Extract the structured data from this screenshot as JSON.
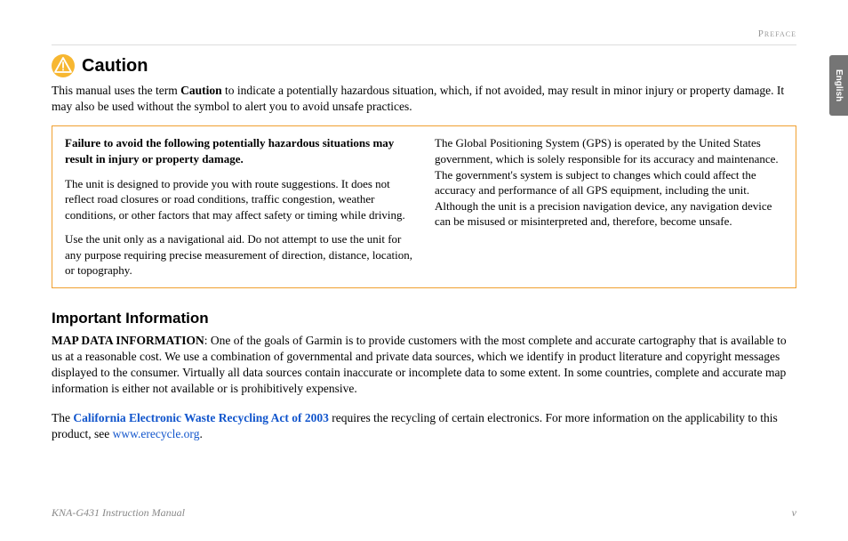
{
  "header": {
    "section_label": "Preface",
    "language_tab": "English"
  },
  "caution": {
    "title": "Caution",
    "intro_pre": "This manual uses the term ",
    "intro_bold": "Caution",
    "intro_post": " to indicate a potentially hazardous situation, which, if not avoided, may result in minor injury or property damage. It may also be used without the symbol to alert you to avoid unsafe practices.",
    "box": {
      "left": {
        "p1_bold": "Failure to avoid the following potentially hazardous situations may result in injury or property damage.",
        "p2": "The unit is designed to provide you with route suggestions. It does not reflect road closures or road conditions, traffic congestion, weather conditions, or other factors that may affect safety or timing while driving.",
        "p3": "Use the unit only as a navigational aid. Do not attempt to use the unit for any purpose requiring precise measurement of direction, distance, location, or topography."
      },
      "right": {
        "p1": "The Global Positioning System (GPS) is operated by the United States government, which is solely responsible for its accuracy and maintenance. The government's system is subject to changes which could affect the accuracy and performance of all GPS equipment, including the unit. Although the unit is a precision navigation device, any navigation device can be misused or misinterpreted and, therefore, become unsafe."
      }
    }
  },
  "important": {
    "title": "Important Information",
    "mapdata_label": "MAP DATA INFORMATION",
    "mapdata_text": ": One of the goals of Garmin is to provide customers with the most complete and accurate cartography that is available to us at a reasonable cost. We use a combination of governmental and private data sources, which we identify in product literature and copyright messages displayed to the consumer. Virtually all data sources contain inaccurate or incomplete data to some extent. In some countries, complete and accurate map information is either not available or is prohibitively expensive.",
    "recycle_pre": "The ",
    "recycle_act": "California Electronic Waste Recycling Act of 2003",
    "recycle_mid": " requires the recycling of certain electronics. For more information on the applicability to this product, see ",
    "recycle_url": "www.erecycle.org",
    "recycle_post": "."
  },
  "footer": {
    "manual_name": "KNA-G431 Instruction Manual",
    "page_number": "v"
  }
}
